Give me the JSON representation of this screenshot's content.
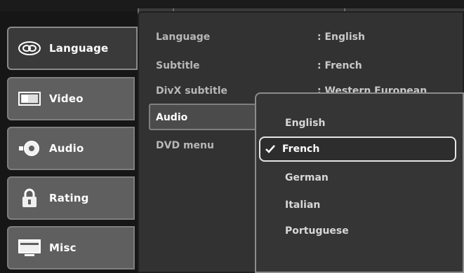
{
  "sidebar": {
    "items": [
      {
        "label": "Language",
        "icon": "language-icon",
        "active": true
      },
      {
        "label": "Video",
        "icon": "video-icon",
        "active": false
      },
      {
        "label": "Audio",
        "icon": "audio-icon",
        "active": false
      },
      {
        "label": "Rating",
        "icon": "lock-icon",
        "active": false
      },
      {
        "label": "Misc",
        "icon": "monitor-icon",
        "active": false
      }
    ]
  },
  "settings": {
    "rows": [
      {
        "label": "Language",
        "value": ": English"
      },
      {
        "label": "Subtitle",
        "value": ": French"
      },
      {
        "label": "DivX subtitle",
        "value": ": Western European"
      },
      {
        "label": "Audio",
        "value": ""
      },
      {
        "label": "DVD menu",
        "value": ""
      }
    ]
  },
  "dropdown": {
    "options": [
      "English",
      "French",
      "German",
      "Italian",
      "Portuguese"
    ],
    "selected": "French"
  },
  "colors": {
    "background": "#323232",
    "sidebar_active": "#3a3a3a",
    "sidebar_inactive": "#5f5f5f",
    "highlight_border": "#e5e5e5"
  }
}
